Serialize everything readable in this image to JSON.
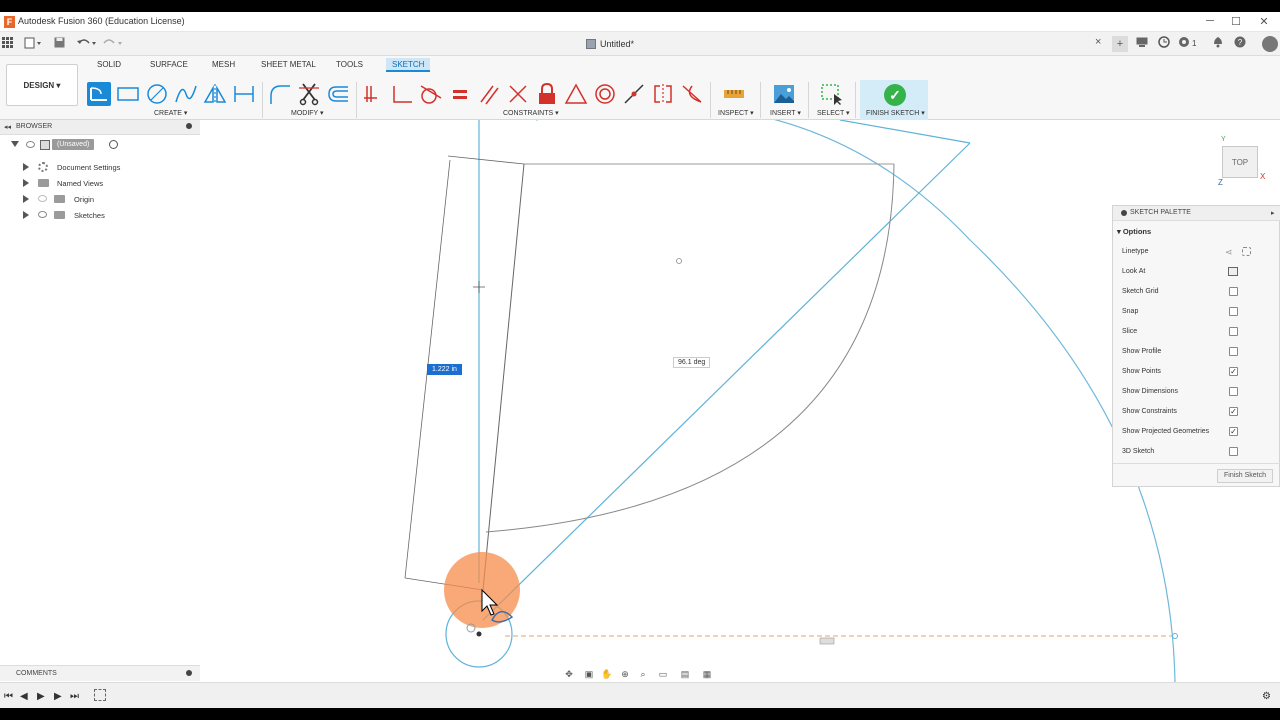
{
  "app": {
    "window_title": "Autodesk Fusion 360 (Education License)",
    "icon_letter": "F",
    "win_controls": [
      "─",
      "☐",
      "✕"
    ]
  },
  "document": {
    "tab_name": "Untitled*",
    "close_label": "×"
  },
  "qa_right": {
    "notifications_count": "1"
  },
  "ribbon": {
    "workspace": "DESIGN ▾",
    "tabs": [
      "SOLID",
      "SURFACE",
      "MESH",
      "SHEET METAL",
      "TOOLS",
      "SKETCH"
    ],
    "active_tab": "SKETCH",
    "groups": {
      "create": "CREATE ▾",
      "modify": "MODIFY ▾",
      "constraints": "CONSTRAINTS ▾",
      "inspect": "INSPECT ▾",
      "insert": "INSERT ▾",
      "select": "SELECT ▾",
      "finish": "FINISH SKETCH ▾"
    }
  },
  "browser": {
    "title": "BROWSER",
    "items": [
      {
        "label": "(Unsaved)"
      },
      {
        "label": "Document Settings"
      },
      {
        "label": "Named Views"
      },
      {
        "label": "Origin"
      },
      {
        "label": "Sketches"
      }
    ]
  },
  "comments": {
    "title": "COMMENTS"
  },
  "canvas": {
    "dim_length": "1.222 in",
    "dim_angle": "96.1 deg",
    "viewcube_label": "TOP",
    "axis_x": "X",
    "axis_y": "Y",
    "axis_z": "Z"
  },
  "palette": {
    "title": "SKETCH PALETTE",
    "section": "▾ Options",
    "rows": [
      {
        "label": "Linetype",
        "checked": null
      },
      {
        "label": "Look At",
        "checked": null
      },
      {
        "label": "Sketch Grid",
        "checked": false
      },
      {
        "label": "Snap",
        "checked": false
      },
      {
        "label": "Slice",
        "checked": false
      },
      {
        "label": "Show Profile",
        "checked": false
      },
      {
        "label": "Show Points",
        "checked": true
      },
      {
        "label": "Show Dimensions",
        "checked": false
      },
      {
        "label": "Show Constraints",
        "checked": true
      },
      {
        "label": "Show Projected Geometries",
        "checked": true
      },
      {
        "label": "3D Sketch",
        "checked": false
      }
    ],
    "finish_button": "Finish Sketch"
  },
  "colors": {
    "accent": "#1a8ad8",
    "finish_green": "#35b34a",
    "sketch_blue": "#5fb3d8",
    "cursor_glow": "#f58c4a"
  }
}
